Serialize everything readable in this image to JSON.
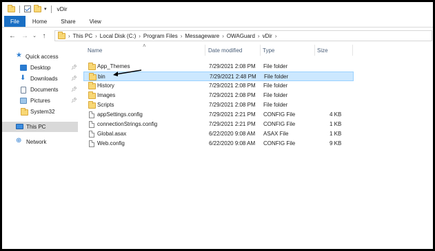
{
  "window": {
    "title": "vDir"
  },
  "ribbon": {
    "tabs": [
      "File",
      "Home",
      "Share",
      "View"
    ]
  },
  "address": {
    "breadcrumb": [
      "This PC",
      "Local Disk (C:)",
      "Program Files",
      "Messageware",
      "OWAGuard",
      "vDir"
    ]
  },
  "nav_pane": {
    "items": [
      {
        "label": "Quick access",
        "icon": "star-icon",
        "pinned": false
      },
      {
        "label": "Desktop",
        "icon": "desktop-icon",
        "pinned": true
      },
      {
        "label": "Downloads",
        "icon": "download-icon",
        "pinned": true
      },
      {
        "label": "Documents",
        "icon": "documents-icon",
        "pinned": true
      },
      {
        "label": "Pictures",
        "icon": "pictures-icon",
        "pinned": true
      },
      {
        "label": "System32",
        "icon": "folder-icon",
        "pinned": false
      },
      {
        "label": "This PC",
        "icon": "computer-icon",
        "pinned": false,
        "selected": true
      },
      {
        "label": "Network",
        "icon": "network-icon",
        "pinned": false
      }
    ]
  },
  "file_list": {
    "columns": [
      "Name",
      "Date modified",
      "Type",
      "Size"
    ],
    "rows": [
      {
        "name": "App_Themes",
        "date": "7/29/2021 2:08 PM",
        "type": "File folder",
        "size": "",
        "kind": "folder"
      },
      {
        "name": "bin",
        "date": "7/29/2021 2:48 PM",
        "type": "File folder",
        "size": "",
        "kind": "folder",
        "selected": true
      },
      {
        "name": "History",
        "date": "7/29/2021 2:08 PM",
        "type": "File folder",
        "size": "",
        "kind": "folder"
      },
      {
        "name": "Images",
        "date": "7/29/2021 2:08 PM",
        "type": "File folder",
        "size": "",
        "kind": "folder"
      },
      {
        "name": "Scripts",
        "date": "7/29/2021 2:08 PM",
        "type": "File folder",
        "size": "",
        "kind": "folder"
      },
      {
        "name": "appSettings.config",
        "date": "7/29/2021 2:21 PM",
        "type": "CONFIG File",
        "size": "4 KB",
        "kind": "file"
      },
      {
        "name": "connectionStrings.config",
        "date": "7/29/2021 2:21 PM",
        "type": "CONFIG File",
        "size": "1 KB",
        "kind": "file"
      },
      {
        "name": "Global.asax",
        "date": "6/22/2020 9:08 AM",
        "type": "ASAX File",
        "size": "1 KB",
        "kind": "file"
      },
      {
        "name": "Web.config",
        "date": "6/22/2020 9:08 AM",
        "type": "CONFIG File",
        "size": "9 KB",
        "kind": "file"
      }
    ]
  },
  "colors": {
    "file_tab": "#1a6fc4",
    "selection_bg": "#cce8ff",
    "selection_border": "#99d1ff",
    "folder": "#f8d775",
    "nav_selected": "#d9d9d9",
    "header_text": "#4c607a"
  }
}
